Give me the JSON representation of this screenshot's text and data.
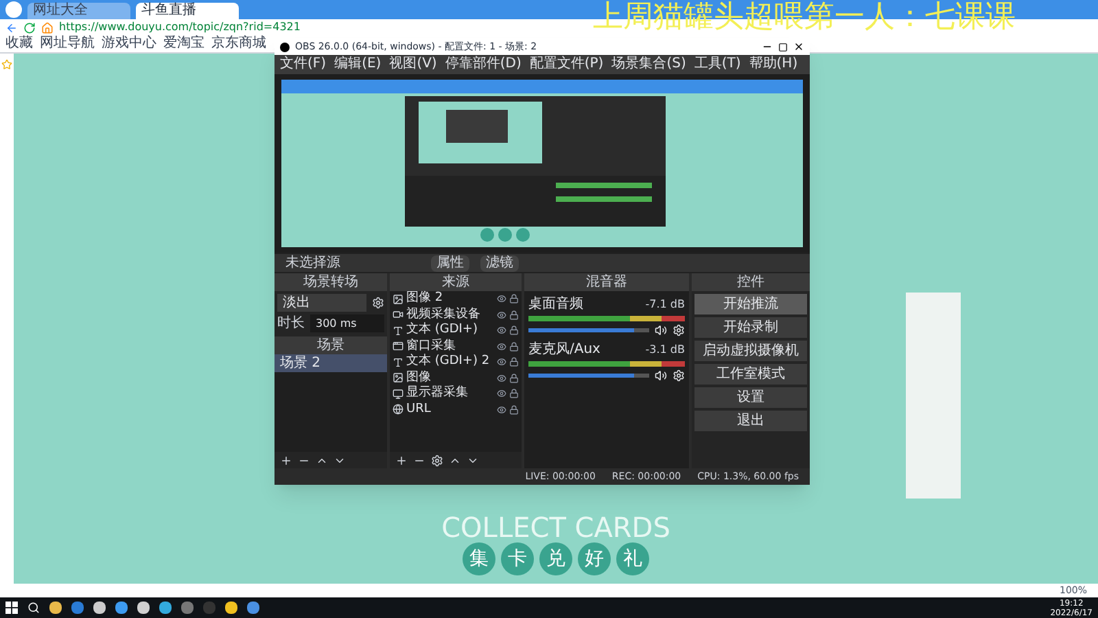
{
  "browser": {
    "tabs": [
      {
        "label": "网址大全",
        "selected": false
      },
      {
        "label": "斗鱼直播",
        "selected": true
      }
    ],
    "url": "https://www.douyu.com/topic/zqn?rid=4321",
    "bookmarks": [
      "收藏",
      "网址导航",
      "游戏中心",
      "爱淘宝",
      "京东商城"
    ],
    "zoom": "100%"
  },
  "overlay_title": "上周猫罐头超喂第一人：七课课",
  "obs": {
    "title": "OBS 26.0.0 (64-bit, windows) - 配置文件: 1 - 场景: 2",
    "menu": [
      "文件(F)",
      "编辑(E)",
      "视图(V)",
      "停靠部件(D)",
      "配置文件(P)",
      "场景集合(S)",
      "工具(T)",
      "帮助(H)"
    ],
    "source_bar": {
      "label": "未选择源",
      "buttons": [
        "属性",
        "滤镜"
      ]
    },
    "transitions": {
      "title": "场景转场",
      "effect": "淡出",
      "duration_label": "时长",
      "duration": "300 ms"
    },
    "scenes": {
      "title": "场景",
      "items": [
        {
          "label": "场景 2",
          "selected": true
        }
      ]
    },
    "sources": {
      "title": "来源",
      "items": [
        {
          "label": "图像 2",
          "kind": "image"
        },
        {
          "label": "视频采集设备",
          "kind": "camera"
        },
        {
          "label": "文本 (GDI+)",
          "kind": "text"
        },
        {
          "label": "窗口采集",
          "kind": "window"
        },
        {
          "label": "文本 (GDI+) 2",
          "kind": "text"
        },
        {
          "label": "图像",
          "kind": "image"
        },
        {
          "label": "显示器采集",
          "kind": "monitor"
        },
        {
          "label": "URL",
          "kind": "browser"
        }
      ]
    },
    "mixer": {
      "title": "混音器",
      "channels": [
        {
          "name": "桌面音频",
          "reading": "-7.1 dB",
          "level": 0.88
        },
        {
          "name": "麦克风/Aux",
          "reading": "-3.1 dB",
          "level": 0.88
        }
      ]
    },
    "controls": {
      "title": "控件",
      "buttons": [
        {
          "label": "开始推流",
          "selected": true
        },
        {
          "label": "开始录制",
          "selected": false
        },
        {
          "label": "启动虚拟摄像机",
          "selected": false
        },
        {
          "label": "工作室模式",
          "selected": false
        },
        {
          "label": "设置",
          "selected": false
        },
        {
          "label": "退出",
          "selected": false
        }
      ]
    },
    "status": [
      "LIVE: 00:00:00",
      "REC: 00:00:00",
      "CPU: 1.3%, 60.00 fps"
    ]
  },
  "page": {
    "banner": "集卡兑好礼",
    "banner_back": "COLLECT CARDS"
  },
  "taskbar": {
    "time": "19:12",
    "date": "2022/6/17"
  }
}
